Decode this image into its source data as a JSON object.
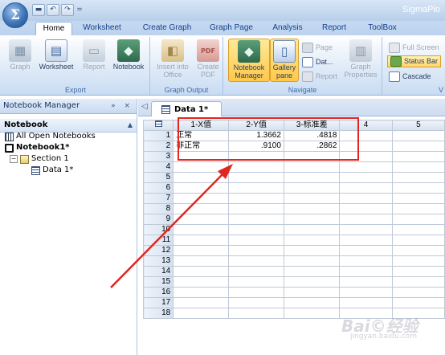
{
  "window": {
    "app_title": "SigmaPlo",
    "orb_glyph": "Σ",
    "qat_more": "="
  },
  "ribbon_tabs": [
    "Home",
    "Worksheet",
    "Create Graph",
    "Graph Page",
    "Analysis",
    "Report",
    "ToolBox"
  ],
  "ribbon": {
    "export": {
      "label": "Export",
      "buttons": [
        "Graph",
        "Worksheet",
        "Report",
        "Notebook"
      ]
    },
    "graph_output": {
      "label": "Graph Output",
      "insert": [
        "Insert into",
        "Office"
      ],
      "save": [
        "Create",
        "PDF"
      ]
    },
    "navigate": {
      "label": "Navigate",
      "notebook_manager": [
        "Notebook",
        "Manager"
      ],
      "gallery_pane": [
        "Gallery",
        "pane"
      ],
      "page": "Page",
      "data": "Dat...",
      "report": "Report",
      "graph_properties": [
        "Graph",
        "Properties"
      ]
    },
    "view": {
      "label": "V",
      "full_screen": "Full Screen",
      "status_bar": "Status Bar",
      "cascade": "Cascade"
    }
  },
  "notebook_manager": {
    "title": "Notebook Manager",
    "header_buttons": "» ×",
    "subheader": "Notebook",
    "tree": {
      "all_open": "All Open Notebooks",
      "notebook": "Notebook1*",
      "section": "Section 1",
      "data": "Data 1*"
    }
  },
  "worksheet": {
    "tab_label": "Data 1*",
    "columns": [
      "1-X值",
      "2-Y值",
      "3-标准差",
      "4",
      "5"
    ],
    "rows": [
      [
        "正常",
        "1.3662",
        ".4818",
        "",
        ""
      ],
      [
        "非正常",
        ".9100",
        ".2862",
        "",
        ""
      ]
    ],
    "row_numbers": [
      "1",
      "2",
      "3",
      "4",
      "5",
      "6",
      "7",
      "8",
      "9",
      "10",
      "11",
      "12",
      "13",
      "14",
      "15",
      "16",
      "17",
      "18"
    ]
  },
  "watermark": {
    "text": "Bai©经验",
    "sub": "jingyan.baidu.com"
  },
  "colors": {
    "accent": "#e2261f",
    "ribbon_bg": "#dde9f7",
    "tab_text": "#15428b"
  }
}
